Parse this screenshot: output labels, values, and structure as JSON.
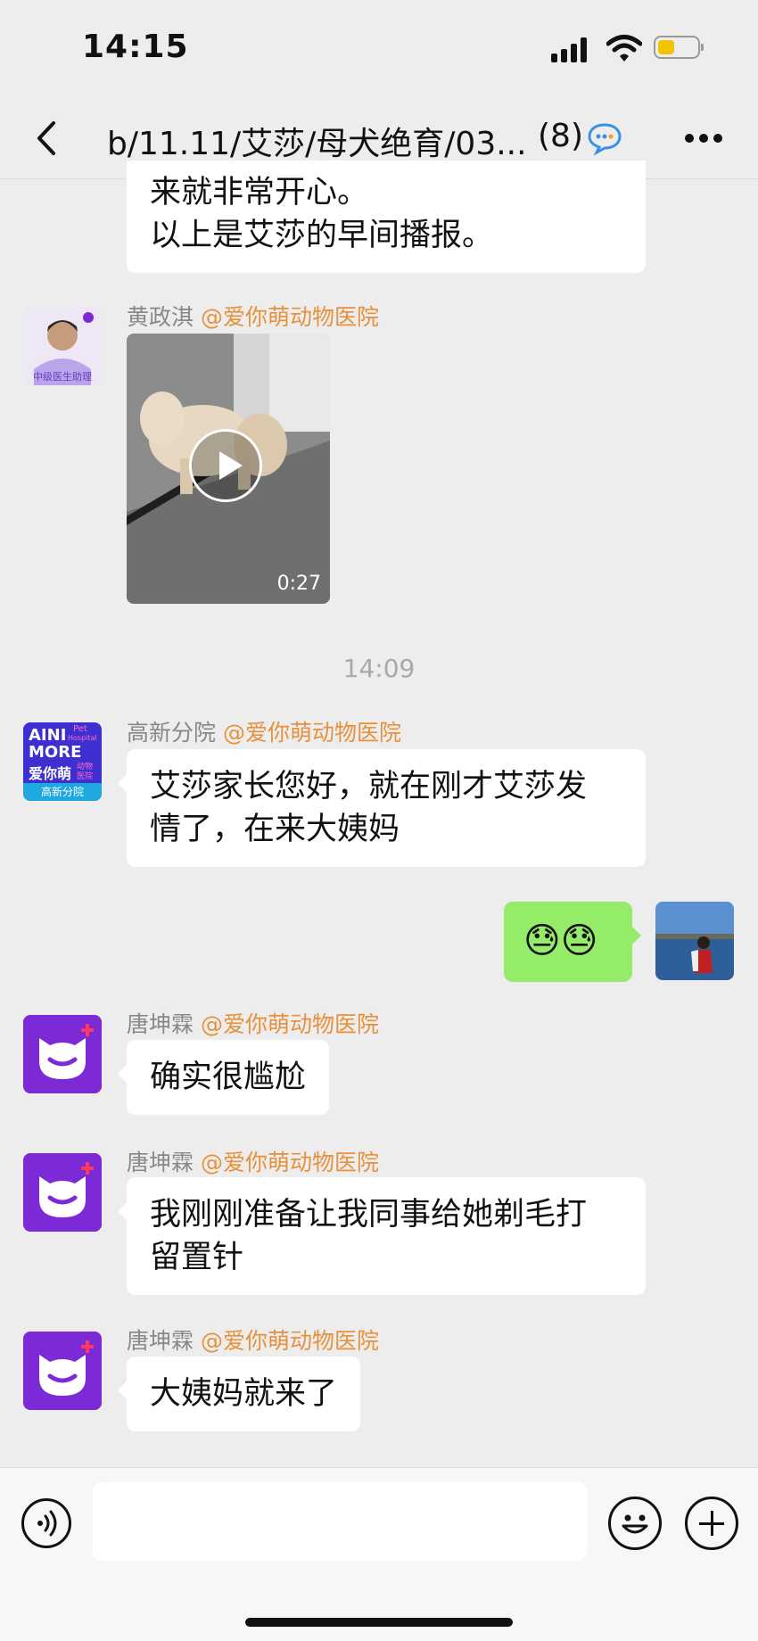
{
  "status_bar": {
    "time": "14:15",
    "battery_color": "#f2c400"
  },
  "nav": {
    "title": "b/11.11/艾莎/母犬绝育/03...",
    "count": "(8)",
    "icons": [
      "back-icon",
      "group-chat-icon",
      "more-icon"
    ]
  },
  "messages": {
    "m0": {
      "lines": [
        "来就非常开心。",
        "以上是艾莎的早间播报。"
      ]
    },
    "m1": {
      "sender": "黄政淇",
      "org": "@爱你萌动物医院",
      "avatar_caption": "中级医生助理",
      "video_duration": "0:27"
    },
    "timestamp": "14:09",
    "m2": {
      "sender": "高新分院",
      "org": "@爱你萌动物医院",
      "avatar": {
        "line1": "AINI",
        "line2": "MORE",
        "line3": "爱你萌",
        "pet": "Pet",
        "hospital": "Hospital",
        "animal": "动物",
        "yiyuan": "医院",
        "branch": "高新分院"
      },
      "lines": [
        "艾莎家长您好，就在刚才艾莎发",
        "情了，在来大姨妈"
      ]
    },
    "m3": {
      "emoji": "😓😓",
      "bubble_color": "#95ec69"
    },
    "m4": {
      "sender": "唐坤霖",
      "org": "@爱你萌动物医院",
      "text": "确实很尴尬"
    },
    "m5": {
      "sender": "唐坤霖",
      "org": "@爱你萌动物医院",
      "lines": [
        "我刚刚准备让我同事给她剃毛打",
        "留置针"
      ]
    },
    "m6": {
      "sender": "唐坤霖",
      "org": "@爱你萌动物医院",
      "text": "大姨妈就来了"
    }
  },
  "colors": {
    "org": "#e8913c",
    "brand_purple": "#7b2ad6",
    "my_bubble": "#95ec69"
  },
  "input_bar": {
    "icons": [
      "voice-icon",
      "emoji-icon",
      "plus-icon"
    ],
    "value": ""
  }
}
